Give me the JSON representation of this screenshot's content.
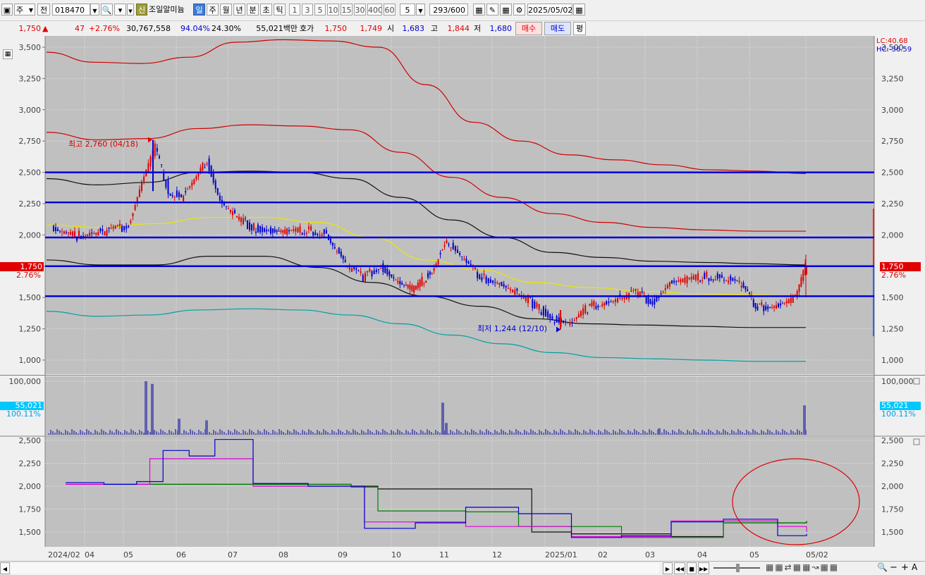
{
  "toolbar": {
    "icon_label": "▣",
    "market_code": "주",
    "prefix": "전",
    "code": "018470",
    "new_badge": "신",
    "stock_name": "조일알미늄",
    "period_buttons": [
      "일",
      "주",
      "월",
      "년",
      "분",
      "초",
      "틱"
    ],
    "active_period": "일",
    "interval_buttons": [
      "1",
      "3",
      "5",
      "10",
      "15",
      "30",
      "400",
      "60"
    ],
    "count_value": "5",
    "count_display": "293/600",
    "date": "2025/05/02"
  },
  "quote": {
    "price": "1,750",
    "arrow": "▲",
    "change": "47",
    "change_pct": "+2.76%",
    "volume": "30,767,558",
    "vol_ratio": "94.04%",
    "turnover": "24.30%",
    "amount": "55,021백만",
    "quote_label": "호가",
    "ask": "1,750",
    "bid": "1,749",
    "open_label": "시",
    "open": "1,683",
    "high_label": "고",
    "high": "1,844",
    "low_label": "저",
    "low": "1,680",
    "buy_label": "매수",
    "sell_label": "매도",
    "eval_label": "평"
  },
  "markers": {
    "current_price": "1,750",
    "current_pct": "2.76%",
    "lc": "LC:40.68",
    "hc": "HC:-36.59",
    "high_note": "최고 2,760 (04/18)",
    "low_note": "최저 1,244 (12/10)",
    "volume_now": "55,021",
    "volume_pct": "100.11%"
  },
  "colors": {
    "up": "#e00000",
    "down": "#0000d0",
    "horizontal_lines": "#0000dd",
    "envelope": "#d00000",
    "mid_band": "#101010",
    "ma_yellow": "#e8e800",
    "lower_band": "#00a0a0",
    "volume_bar": "#6060b0",
    "circle": "#e00000"
  },
  "chart_data": [
    {
      "type": "candlestick",
      "ylim": [
        900,
        3600
      ],
      "y_ticks": [
        "3,500",
        "3,250",
        "3,000",
        "2,750",
        "2,500",
        "2,250",
        "2,000",
        "1,750",
        "1,500",
        "1,250",
        "1,000"
      ],
      "x_ticks": [
        "2024/02",
        "04",
        "05",
        "06",
        "07",
        "08",
        "09",
        "10",
        "11",
        "12",
        "2025/01",
        "02",
        "03",
        "04",
        "05",
        "05/02"
      ],
      "horizontal_lines": [
        2500,
        2260,
        1980,
        1750,
        1510
      ],
      "highest": {
        "label": "2024/04/18",
        "value": 2760
      },
      "lowest": {
        "label": "2024/12/10",
        "value": 1244
      },
      "last_close": 1750,
      "close_path": [
        [
          "2024/02",
          2050
        ],
        [
          "2024/02",
          2010
        ],
        [
          "2024/02",
          1990
        ],
        [
          "2024/03",
          2030
        ],
        [
          "2024/03",
          2020
        ],
        [
          "2024/03",
          2040
        ],
        [
          "2024/04",
          2080
        ],
        [
          "2024/04",
          2420
        ],
        [
          "2024/04",
          2700
        ],
        [
          "2024/04",
          2350
        ],
        [
          "2024/05",
          2300
        ],
        [
          "2024/05",
          2420
        ],
        [
          "2024/05",
          2600
        ],
        [
          "2024/05",
          2280
        ],
        [
          "2024/06",
          2150
        ],
        [
          "2024/06",
          2060
        ],
        [
          "2024/06",
          2030
        ],
        [
          "2024/07",
          2020
        ],
        [
          "2024/07",
          2040
        ],
        [
          "2024/07",
          2010
        ],
        [
          "2024/08",
          1760
        ],
        [
          "2024/08",
          1660
        ],
        [
          "2024/08",
          1750
        ],
        [
          "2024/09",
          1620
        ],
        [
          "2024/09",
          1560
        ],
        [
          "2024/09",
          1700
        ],
        [
          "2024/10",
          1950
        ],
        [
          "2024/10",
          1780
        ],
        [
          "2024/10",
          1660
        ],
        [
          "2024/11",
          1620
        ],
        [
          "2024/11",
          1530
        ],
        [
          "2024/11",
          1440
        ],
        [
          "2024/12",
          1330
        ],
        [
          "2024/12",
          1280
        ],
        [
          "2024/12",
          1420
        ],
        [
          "2025/01",
          1470
        ],
        [
          "2025/01",
          1500
        ],
        [
          "2025/01",
          1540
        ],
        [
          "2025/02",
          1460
        ],
        [
          "2025/02",
          1620
        ],
        [
          "2025/02",
          1640
        ],
        [
          "2025/03",
          1670
        ],
        [
          "2025/03",
          1660
        ],
        [
          "2025/03",
          1610
        ],
        [
          "2025/04",
          1420
        ],
        [
          "2025/04",
          1440
        ],
        [
          "2025/04",
          1500
        ],
        [
          "2025/05",
          1750
        ]
      ],
      "envelope_upper": [
        3460,
        3380,
        3370,
        3420,
        3540,
        3560,
        3550,
        3500,
        3200,
        2900,
        2750,
        2640,
        2600,
        2560,
        2520,
        2510,
        2490
      ],
      "envelope_inner": [
        2820,
        2760,
        2770,
        2850,
        2880,
        2870,
        2840,
        2660,
        2460,
        2300,
        2170,
        2100,
        2060,
        2040,
        2030,
        2030
      ],
      "mid_line": [
        2450,
        2400,
        2420,
        2500,
        2510,
        2500,
        2450,
        2300,
        2120,
        1980,
        1860,
        1820,
        1790,
        1780,
        1770,
        1760
      ],
      "ma_yellow": [
        2080,
        2060,
        2090,
        2140,
        2140,
        2100,
        1980,
        1800,
        1720,
        1620,
        1580,
        1550,
        1530,
        1520,
        1510
      ],
      "lower_band": [
        1390,
        1350,
        1360,
        1400,
        1410,
        1400,
        1360,
        1290,
        1200,
        1130,
        1060,
        1020,
        1010,
        1000,
        990,
        990
      ],
      "support_line": [
        1800,
        1760,
        1760,
        1830,
        1830,
        1740,
        1620,
        1510,
        1430,
        1330,
        1290,
        1280,
        1270,
        1260,
        1260
      ]
    },
    {
      "type": "bar",
      "title": "",
      "ylim": [
        0,
        100000
      ],
      "y_ticks": [
        "100,000"
      ],
      "last_value": 55021,
      "spikes": [
        [
          "2024/04",
          100000
        ],
        [
          "2024/04",
          95000
        ],
        [
          "2024/05",
          30000
        ],
        [
          "2024/05",
          27000
        ],
        [
          "2024/10",
          60000
        ],
        [
          "2024/10",
          22000
        ],
        [
          "2025/02",
          12000
        ],
        [
          "2025/05",
          55021
        ]
      ]
    },
    {
      "type": "line",
      "ylim": [
        1400,
        2550
      ],
      "y_ticks": [
        "2,500",
        "2,250",
        "2,000",
        "1,750",
        "1,500"
      ],
      "series_colors": [
        "#0000d0",
        "#e000e0",
        "#008000",
        "#101010"
      ],
      "blue_path": [
        [
          "2024/02",
          2040
        ],
        [
          "2024/03",
          2020
        ],
        [
          "2024/04",
          2050
        ],
        [
          "2024/04",
          2390
        ],
        [
          "2024/05",
          2330
        ],
        [
          "2024/05",
          2510
        ],
        [
          "2024/06",
          2030
        ],
        [
          "2024/07",
          2000
        ],
        [
          "2024/08",
          1540
        ],
        [
          "2024/09",
          1600
        ],
        [
          "2024/10",
          1770
        ],
        [
          "2024/11",
          1700
        ],
        [
          "2024/12",
          1440
        ],
        [
          "2025/01",
          1460
        ],
        [
          "2025/02",
          1610
        ],
        [
          "2025/03",
          1640
        ],
        [
          "2025/04",
          1460
        ],
        [
          "2025/05",
          1480
        ]
      ],
      "magenta_path": [
        [
          "2024/02",
          2020
        ],
        [
          "2024/04",
          2300
        ],
        [
          "2024/06",
          2000
        ],
        [
          "2024/08",
          1610
        ],
        [
          "2024/10",
          1560
        ],
        [
          "2024/12",
          1450
        ],
        [
          "2025/02",
          1620
        ],
        [
          "2025/04",
          1560
        ],
        [
          "2025/05",
          1500
        ]
      ],
      "annotation": "circle around 2025/04-05"
    }
  ]
}
